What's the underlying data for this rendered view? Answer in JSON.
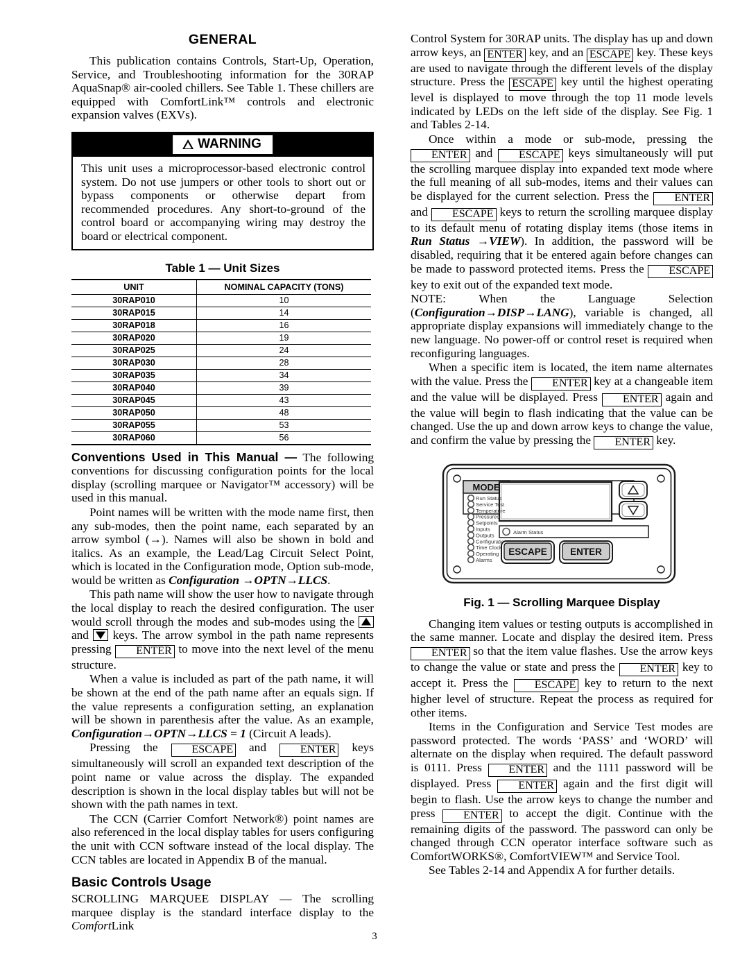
{
  "page": {
    "number": "3"
  },
  "left": {
    "heading": "GENERAL",
    "intro": "This publication contains Controls, Start-Up, Operation, Service, and Troubleshooting information for the 30RAP AquaSnap® air-cooled chillers. See Table 1. These chillers are equipped with ComfortLink™ controls and electronic expansion valves (EXVs).",
    "warning": {
      "label": "WARNING",
      "body": "This unit uses a microprocessor-based electronic control system. Do not use jumpers or other tools to short out or bypass components or otherwise depart from recommended procedures. Any short-to-ground of the control board or accompanying wiring may destroy the board or electrical component."
    },
    "table": {
      "title": "Table 1 — Unit Sizes",
      "columns": [
        "UNIT",
        "NOMINAL CAPACITY (TONS)"
      ],
      "rows": [
        [
          "30RAP010",
          "10"
        ],
        [
          "30RAP015",
          "14"
        ],
        [
          "30RAP018",
          "16"
        ],
        [
          "30RAP020",
          "19"
        ],
        [
          "30RAP025",
          "24"
        ],
        [
          "30RAP030",
          "28"
        ],
        [
          "30RAP035",
          "34"
        ],
        [
          "30RAP040",
          "39"
        ],
        [
          "30RAP045",
          "43"
        ],
        [
          "30RAP050",
          "48"
        ],
        [
          "30RAP055",
          "53"
        ],
        [
          "30RAP060",
          "56"
        ]
      ]
    },
    "conventions": {
      "runhead": "Conventions Used in This Manual —",
      "p1_rest": " The following conventions for discussing configuration points for the local display (scrolling marquee or Navigator™ accessory) will be used in this manual.",
      "p2_a": "Point names will be written with the mode name first, then any sub-modes, then the point name, each separated by an arrow symbol (→). Names will also be shown in bold and italics. As an example, the Lead/Lag Circuit Select Point, which is located in the Configuration mode, Option sub-mode, would be written as ",
      "p2_path": "Configuration →OPTN→LLCS",
      "p2_b": ".",
      "p3_a": "This path name will show the user how to navigate through the local display to reach the desired configuration. The user would scroll through the modes and sub-modes using the ",
      "p3_b": " and ",
      "p3_c": " keys. The arrow symbol in the path name represents pressing ",
      "p3_key": "ENTER",
      "p3_d": " to move into the next level of the menu structure.",
      "p4_a": "When a value is included as part of the path name, it will be shown at the end of the path name after an equals sign. If the value represents a configuration setting, an explanation will be shown in parenthesis after the value. As an example, ",
      "p4_path": "Configuration→OPTN→LLCS = 1",
      "p4_b": " (Circuit A leads).",
      "p5_a": "Pressing the ",
      "p5_key1": "ESCAPE",
      "p5_b": " and ",
      "p5_key2": "ENTER",
      "p5_c": " keys simultaneously will scroll an expanded text description of the point name or value across the display. The expanded description is shown in the local display tables but will not be shown with the path names in text.",
      "p6_a": "The CCN (Carrier Comfort Network®) point names are also referenced in the local display tables for users configuring the unit with CCN software instead of the local display. The CCN tables are located in Appendix B of the manual."
    },
    "basic": {
      "heading": "Basic Controls Usage",
      "p1_a": "SCROLLING MARQUEE DISPLAY — The scrolling marquee display is the standard interface display to the ",
      "p1_ital": "Comfort",
      "p1_b": "Link"
    }
  },
  "right": {
    "p1_a": "Control System for 30RAP units. The display has up and down arrow keys, an ",
    "p1_key1": "ENTER",
    "p1_b": " key, and an ",
    "p1_key2": "ESCAPE",
    "p1_c": " key. These keys are used to navigate through the different levels of the display structure. Press the ",
    "p1_key3": "ESCAPE",
    "p1_d": " key until the highest operating level is displayed to move through the top 11 mode levels indicated by LEDs on the left side of the display. See Fig. 1 and Tables 2-14.",
    "p2_a": "Once within a mode or sub-mode, pressing the ",
    "p2_key1": "ENTER",
    "p2_b": " and ",
    "p2_key2": "ESCAPE",
    "p2_c": " keys simultaneously will put the scrolling marquee display into expanded text mode where the full meaning of all sub-modes, items and their values can be displayed for the current selection. Press the ",
    "p2_key3": "ENTER",
    "p2_d": " and ",
    "p2_key4": "ESCAPE",
    "p2_e": " keys to return the scrolling marquee display to its default menu of rotating display items (those items in ",
    "p2_path": "Run Status →VIEW",
    "p2_f": "). In addition, the password will be disabled, requiring that it be entered again before changes can be made to password protected items. Press the ",
    "p2_key5": "ESCAPE",
    "p2_g": " key to exit out of the expanded text mode.",
    "note_a": "NOTE: When the Language Selection (",
    "note_path1": "Configuration→",
    "note_path2": "DISP→LANG",
    "note_b": "), variable is changed, all appropriate display expansions will immediately change to the new language. No power-off or control reset is required when reconfiguring languages.",
    "p4_a": "When a specific item is located, the item name alternates with the value. Press the ",
    "p4_key1": "ENTER",
    "p4_b": " key at a changeable item and the value will be displayed. Press ",
    "p4_key2": "ENTER",
    "p4_c": " again and the value will begin to flash indicating that the value can be changed. Use the up and down arrow keys to change the value, and confirm the value by pressing the ",
    "p4_key3": "ENTER",
    "p4_d": " key.",
    "figure": {
      "caption": "Fig. 1 — Scrolling Marquee Display",
      "mode_label": "MODE",
      "modes": [
        "Run Status",
        "Service Test",
        "Temperature",
        "Pressures",
        "Setpoints",
        "Inputs",
        "Outputs",
        "Configuration",
        "Time Clock",
        "Operating Modes",
        "Alarms"
      ],
      "alarm_status": "Alarm Status",
      "escape_button": "ESCAPE",
      "enter_button": "ENTER",
      "up_arrow": "△",
      "down_arrow": "▽"
    },
    "p5_a": "Changing item values or testing outputs is accomplished in the same manner. Locate and display the desired item. Press ",
    "p5_key1": "ENTER",
    "p5_b": " so that the item value flashes. Use the arrow keys to change the value or state and press the ",
    "p5_key2": "ENTER",
    "p5_c": " key to accept it. Press the ",
    "p5_key3": "ESCAPE",
    "p5_d": " key to return to the next higher level of structure. Repeat the process as required for other items.",
    "p6_a": "Items in the Configuration and Service Test modes are password protected. The words ‘PASS’ and ‘WORD’ will alternate on the display when required. The default password is 0111. Press ",
    "p6_key1": "ENTER",
    "p6_b": " and the 1111 password will be displayed. Press ",
    "p6_key2": "ENTER",
    "p6_c": " again and the first digit will begin to flash. Use the arrow keys to change the number and press ",
    "p6_key3": "ENTER",
    "p6_d": " to accept the digit. Continue with the remaining digits of the password. The password can only be changed through CCN operator interface software such as ComfortWORKS®, ComfortVIEW™ and Service Tool.",
    "p7": "See Tables 2-14 and Appendix A for further details."
  }
}
